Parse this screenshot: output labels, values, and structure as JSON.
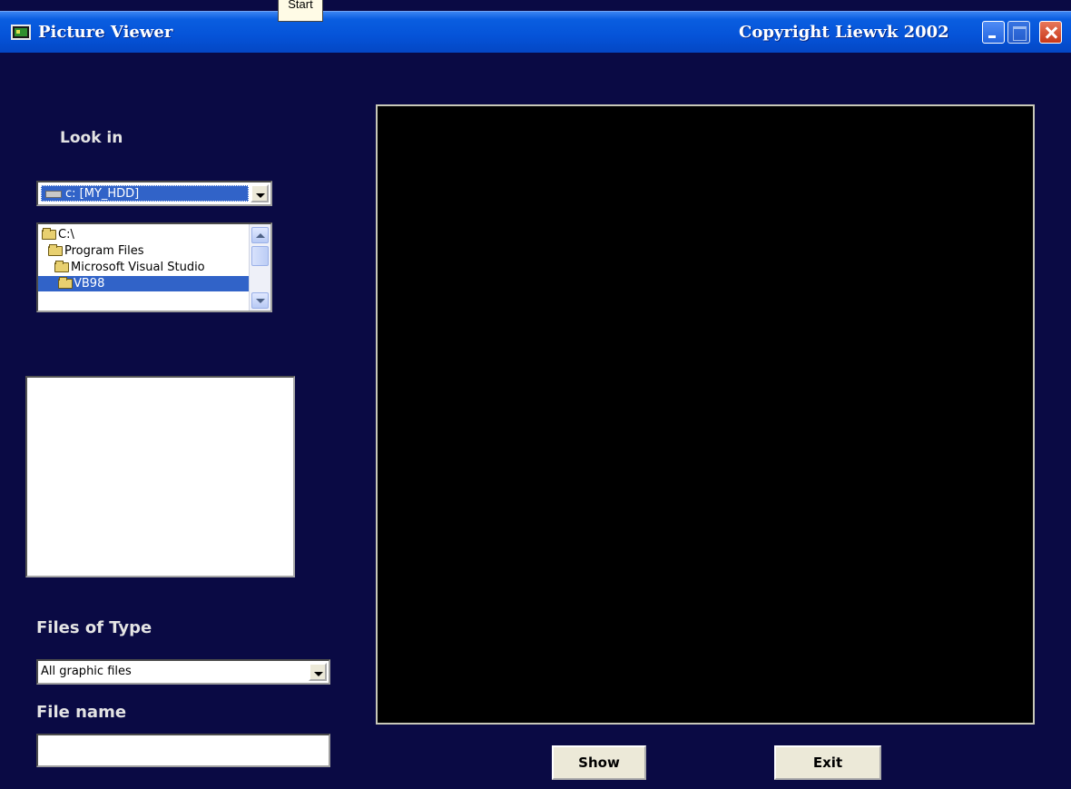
{
  "window": {
    "title": "Picture Viewer",
    "copyright": "Copyright Liewvk  2002",
    "tooltip": "Start"
  },
  "look_in": {
    "label": "Look in",
    "drive": "c: [MY_HDD]",
    "directories": [
      {
        "label": "C:\\",
        "selected": false
      },
      {
        "label": "Program Files",
        "selected": false
      },
      {
        "label": "Microsoft Visual Studio",
        "selected": false
      },
      {
        "label": "VB98",
        "selected": true
      }
    ]
  },
  "files": {
    "items": []
  },
  "files_of_type": {
    "label": "Files of Type",
    "value": "All graphic files"
  },
  "file_name": {
    "label": "File name",
    "value": ""
  },
  "buttons": {
    "show": "Show",
    "exit": "Exit"
  },
  "icons": {
    "app": "picture-viewer-app-icon",
    "drive": "hard-drive-icon",
    "folder": "folder-icon"
  },
  "colors": {
    "background": "#0a0a44",
    "titlebar": "#0553d8",
    "selection": "#3163c8",
    "picture_bg": "#000000"
  }
}
